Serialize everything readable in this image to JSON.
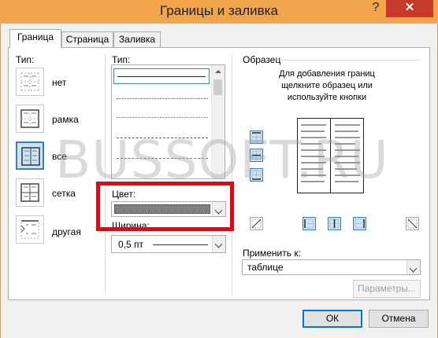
{
  "window": {
    "title": "Границы и заливка",
    "help_label": "?",
    "close_label": "✕"
  },
  "tabs": [
    {
      "label": "Граница",
      "active": true
    },
    {
      "label": "Страница",
      "active": false
    },
    {
      "label": "Заливка",
      "active": false
    }
  ],
  "setting": {
    "label": "Тип:",
    "items": [
      {
        "label": "нет",
        "icon": "border-none-icon"
      },
      {
        "label": "рамка",
        "icon": "border-box-icon"
      },
      {
        "label": "все",
        "icon": "border-all-icon",
        "selected": true
      },
      {
        "label": "сетка",
        "icon": "border-grid-icon"
      },
      {
        "label": "другая",
        "icon": "border-custom-icon"
      }
    ]
  },
  "style": {
    "label": "Тип:"
  },
  "color": {
    "label": "Цвет:",
    "value": ""
  },
  "width": {
    "label": "Ширина:",
    "value": "0,5 пт"
  },
  "preview": {
    "label": "Образец",
    "hint_line1": "Для добавления границ",
    "hint_line2": "щелкните образец или",
    "hint_line3": "используйте кнопки"
  },
  "apply_to": {
    "label": "Применить к:",
    "value": "таблице"
  },
  "buttons": {
    "options": "Параметры...",
    "ok": "ОК",
    "cancel": "Отмена"
  },
  "watermark": "BUSSOFT.RU",
  "colors": {
    "titlebar": "#f0a54c",
    "close": "#c7392b",
    "highlight": "#e30613",
    "accent": "#3c7fb1"
  }
}
